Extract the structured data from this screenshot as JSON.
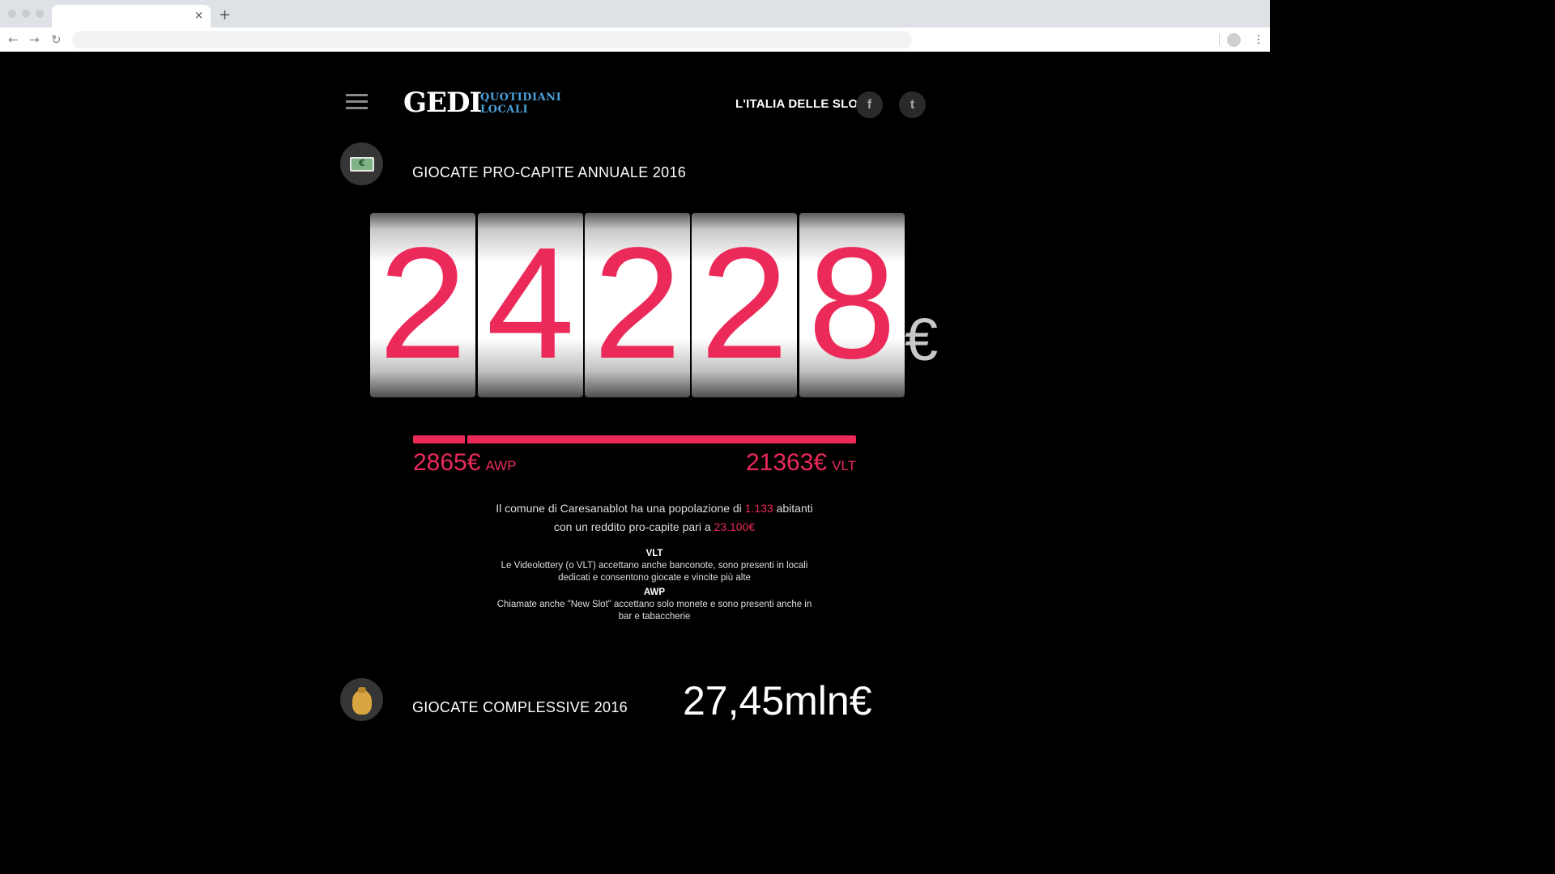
{
  "browser": {
    "tab_close": "×",
    "new_tab": "+",
    "nav": {
      "back": "←",
      "forward": "→",
      "reload": "↻"
    },
    "menu": "⋮"
  },
  "header": {
    "logo_main": "GEDI",
    "logo_sub_1": "QUOTIDIANI",
    "logo_sub_2": "LOCALI",
    "title": "L'ITALIA DELLE SLOT",
    "facebook": "f",
    "twitter": "t",
    "accent_color": "#4aa0d8"
  },
  "section1": {
    "icon": "cash-icon",
    "title": "GIOCATE PRO-CAPITE ANNUALE 2016",
    "digits": [
      "2",
      "4",
      "2",
      "2",
      "8"
    ],
    "currency": "€",
    "awp_amount": "2865€",
    "awp_label": "AWP",
    "vlt_amount": "21363€",
    "vlt_label": "VLT",
    "awp_value": 2865,
    "vlt_value": 21363,
    "highlight_color": "#ec2a5a",
    "line1_a": "Il comune di Caresanablot ha una popolazione di",
    "line1_hl": "1.133",
    "line1_b": "abitanti",
    "line2_a": "con un reddito pro-capite pari a",
    "line2_hl": "23.100€",
    "vlt_term": "VLT",
    "vlt_desc": "Le Videolottery (o VLT) accettano anche banconote, sono presenti in locali dedicati e consentono giocate e vincite più alte",
    "awp_term": "AWP",
    "awp_desc": "Chiamate anche \"New Slot\" accettano solo monete e sono presenti anche in bar e tabaccherie"
  },
  "section2": {
    "icon": "money-bag-icon",
    "title": "GIOCATE COMPLESSIVE 2016",
    "total": "27,45mln€"
  }
}
